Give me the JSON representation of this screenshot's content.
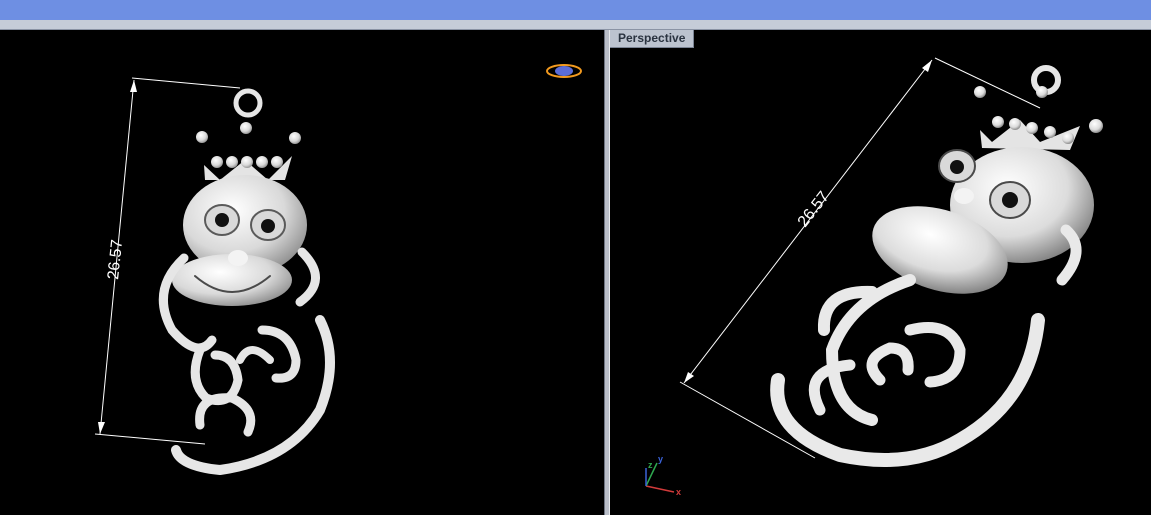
{
  "window": {
    "title_bar_color": "#6e8fe3"
  },
  "viewports": {
    "left": {
      "dimension_value": "26.57"
    },
    "right": {
      "label": "Perspective",
      "dimension_value": "26.57"
    }
  },
  "axes": {
    "x": "x",
    "y": "y",
    "z": "z"
  },
  "colors": {
    "model": "#e9e9e9",
    "background": "#000000",
    "dimension": "#ffffff"
  },
  "icons": {
    "view_cube": "orbit-icon"
  }
}
